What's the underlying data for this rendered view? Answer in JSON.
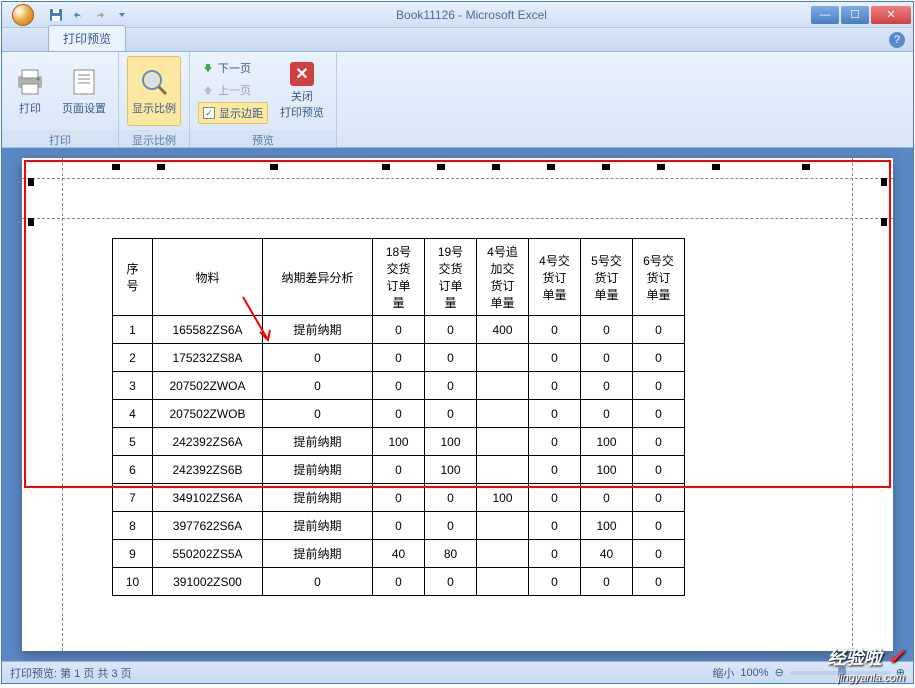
{
  "title": "Book11126 - Microsoft Excel",
  "tab": "打印预览",
  "ribbon": {
    "group1": {
      "print": "打印",
      "setup": "页面设置",
      "label": "打印"
    },
    "group2": {
      "zoom": "显示比例",
      "label": "显示比例"
    },
    "group3": {
      "next": "下一页",
      "prev": "上一页",
      "margins": "显示边距",
      "close": "关闭\n打印预览",
      "label": "预览"
    }
  },
  "table": {
    "headers": [
      "序号",
      "物料",
      "纳期差异分析",
      "18号交货订单量",
      "19号交货订单量",
      "4号追加交货订单量",
      "4号交货订单量",
      "5号交货订单量",
      "6号交货订单量"
    ],
    "rows": [
      [
        "1",
        "165582ZS6A",
        "提前纳期",
        "0",
        "0",
        "400",
        "0",
        "0",
        "0"
      ],
      [
        "2",
        "175232ZS8A",
        "0",
        "0",
        "0",
        "",
        "0",
        "0",
        "0"
      ],
      [
        "3",
        "207502ZWOA",
        "0",
        "0",
        "0",
        "",
        "0",
        "0",
        "0"
      ],
      [
        "4",
        "207502ZWOB",
        "0",
        "0",
        "0",
        "",
        "0",
        "0",
        "0"
      ],
      [
        "5",
        "242392ZS6A",
        "提前纳期",
        "100",
        "100",
        "",
        "0",
        "100",
        "0"
      ],
      [
        "6",
        "242392ZS6B",
        "提前纳期",
        "0",
        "100",
        "",
        "0",
        "100",
        "0"
      ],
      [
        "7",
        "349102ZS6A",
        "提前纳期",
        "0",
        "0",
        "100",
        "0",
        "0",
        "0"
      ],
      [
        "8",
        "3977622S6A",
        "提前纳期",
        "0",
        "0",
        "",
        "0",
        "100",
        "0"
      ],
      [
        "9",
        "550202ZS5A",
        "提前纳期",
        "40",
        "80",
        "",
        "0",
        "40",
        "0"
      ],
      [
        "10",
        "391002ZS00",
        "0",
        "0",
        "0",
        "",
        "0",
        "0",
        "0"
      ]
    ]
  },
  "status": {
    "left": "打印预览: 第 1 页 共 3 页",
    "zoom_label": "缩小",
    "zoom_pct": "100%"
  },
  "watermark": {
    "text": "经验啦",
    "url": "jingyanla.com"
  }
}
